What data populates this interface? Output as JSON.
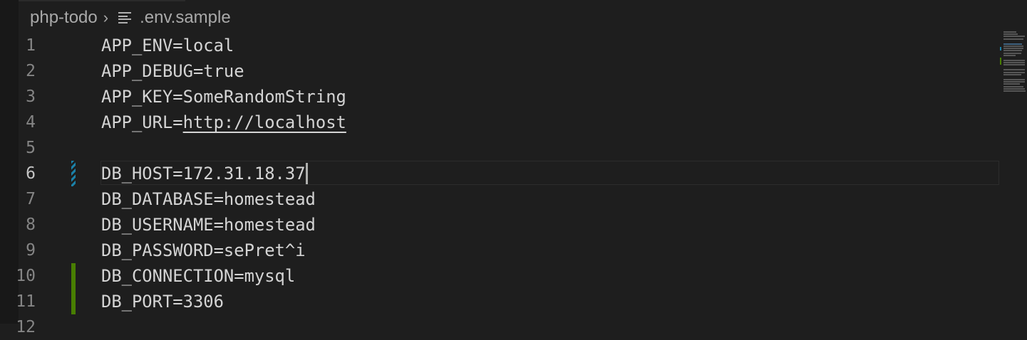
{
  "breadcrumb": {
    "folder": "php-todo",
    "separator": "›",
    "file": ".env.sample",
    "file_icon": "lines-icon"
  },
  "editor": {
    "lines": [
      {
        "num": "1",
        "text": "APP_ENV=local"
      },
      {
        "num": "2",
        "text": "APP_DEBUG=true"
      },
      {
        "num": "3",
        "text": "APP_KEY=SomeRandomString"
      },
      {
        "num": "4",
        "key": "APP_URL=",
        "link": "http://localhost"
      },
      {
        "num": "5",
        "text": ""
      },
      {
        "num": "6",
        "text": "DB_HOST=172.31.18.37"
      },
      {
        "num": "7",
        "text": "DB_DATABASE=homestead"
      },
      {
        "num": "8",
        "text": "DB_USERNAME=homestead"
      },
      {
        "num": "9",
        "text": "DB_PASSWORD=sePret^i"
      },
      {
        "num": "10",
        "text": "DB_CONNECTION=mysql"
      },
      {
        "num": "11",
        "text": "DB_PORT=3306"
      },
      {
        "num": "12",
        "text": ""
      }
    ],
    "active_line": "6"
  },
  "colors": {
    "modified": "#1b81a8",
    "added": "#487e02",
    "background": "#1e1e1e"
  }
}
